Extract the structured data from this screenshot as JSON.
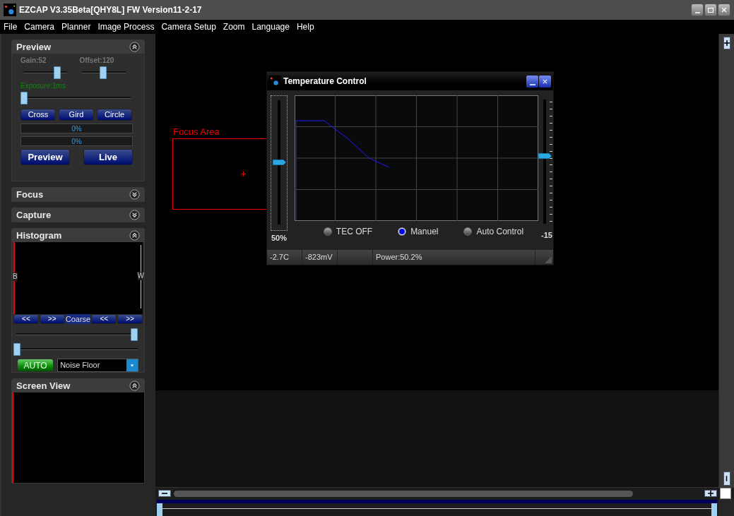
{
  "window": {
    "title": "EZCAP V3.35Beta[QHY8L] FW Version11-2-17"
  },
  "menu": [
    "File",
    "Camera",
    "Planner",
    "Image Process",
    "Camera Setup",
    "Zoom",
    "Language",
    "Help"
  ],
  "panels": [
    {
      "kind": "preview",
      "title": "Preview",
      "expanded": true,
      "gain": {
        "label": "Gain:52",
        "level": 0.83
      },
      "offset": {
        "label": "Offset:120",
        "level": 0.47
      },
      "exposure": {
        "label": "Exposure:1ms",
        "level": 0
      },
      "overlay_buttons": [
        "Cross",
        "Gird",
        "Circle"
      ],
      "progress": [
        {
          "reading": "0%",
          "level": 0
        },
        {
          "reading": "0%",
          "level": 0
        }
      ],
      "action_buttons": [
        "Preview",
        "Live"
      ]
    },
    {
      "title": "Focus",
      "expanded": false
    },
    {
      "title": "Capture",
      "expanded": false
    },
    {
      "kind": "histogram",
      "title": "Histogram",
      "expanded": true,
      "black_marker": "B",
      "white_marker": "W",
      "nav_buttons": [
        "<<",
        ">>",
        "Coarse",
        "<<",
        ">>"
      ],
      "upper_slider": {
        "level": 1
      },
      "lower_slider": {
        "level": 0
      },
      "auto_button": "AUTO",
      "mode": {
        "value": "Noise Floor"
      }
    },
    {
      "kind": "screen",
      "title": "Screen View",
      "expanded": true
    }
  ],
  "canvas": {
    "focus_area": {
      "label": "Focus Area"
    }
  },
  "frame_range": {
    "start": {
      "level": 0
    },
    "end": {
      "level": 1
    }
  },
  "dialog": {
    "title": "Temperature Control",
    "power_slider": {
      "level": 0.5,
      "reading": "50%"
    },
    "target_slider": {
      "level": 0.55,
      "reading": "-15"
    },
    "modes": [
      {
        "label": "TEC OFF",
        "selected": false
      },
      {
        "label": "Manuel",
        "selected": true
      },
      {
        "label": "Auto Control",
        "selected": false
      }
    ],
    "status": {
      "temperature": "-2.7C",
      "voltage": "-823mV",
      "power": "Power:50.2%"
    }
  }
}
